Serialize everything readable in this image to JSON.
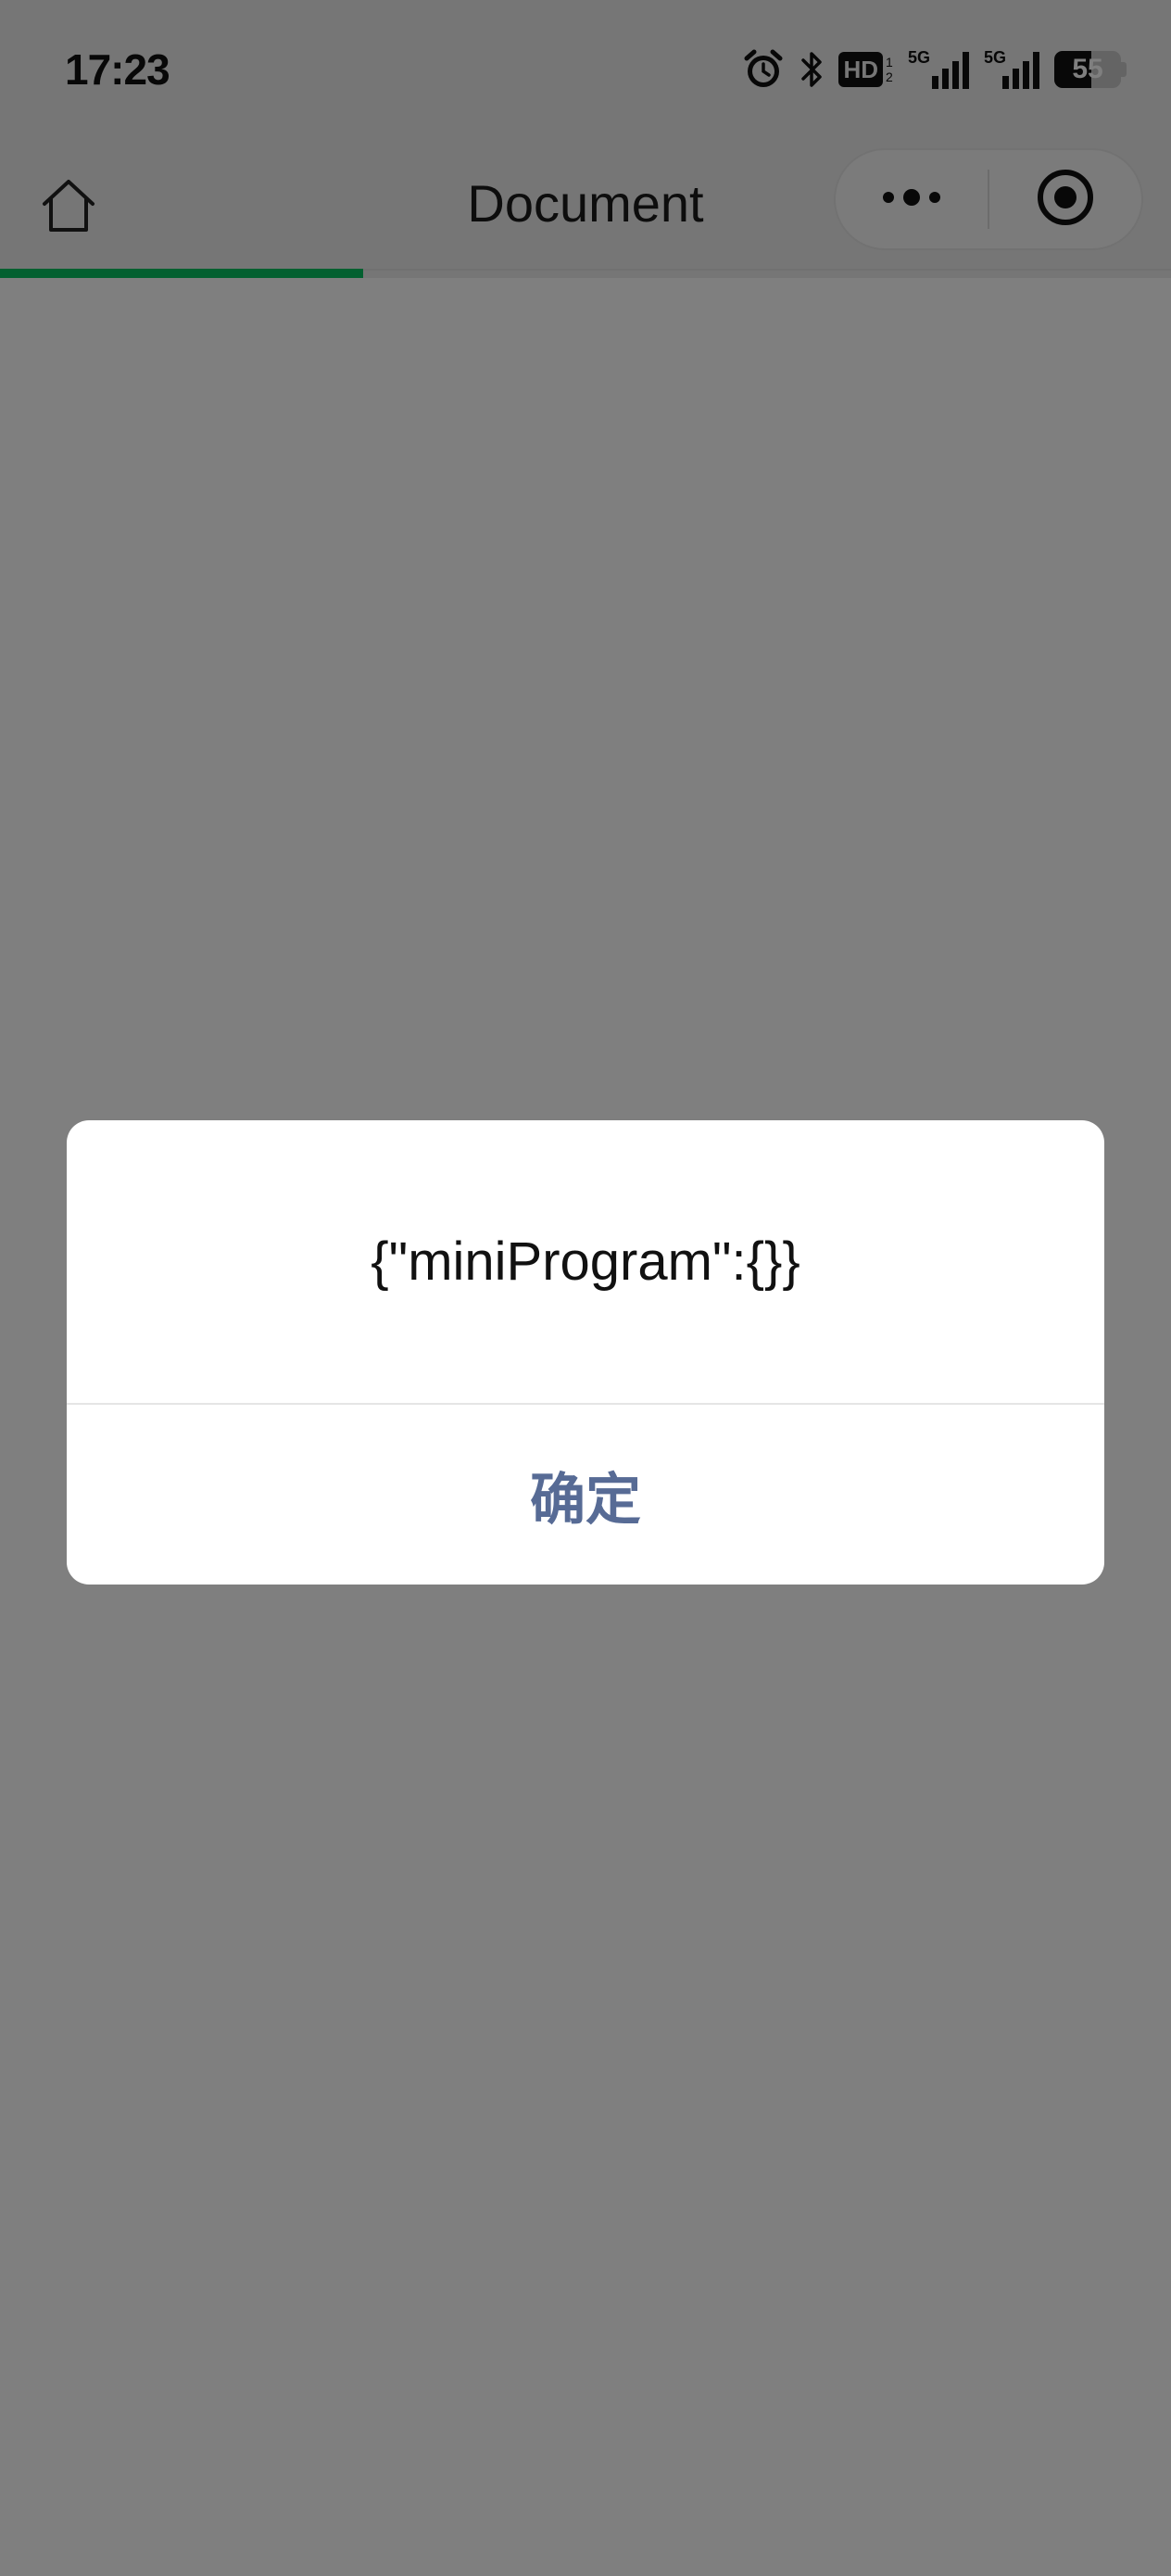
{
  "status_bar": {
    "time": "17:23",
    "hd_label": "HD",
    "hd_sub": "1 2",
    "net1_label": "5G",
    "net2_label": "5G",
    "battery": "55"
  },
  "nav": {
    "title": "Document",
    "home_icon": "home-icon",
    "more_icon": "more-dots-icon",
    "close_icon": "target-close-icon"
  },
  "progress": {
    "value": 0.31,
    "color": "#07c160"
  },
  "modal": {
    "content": "{\"miniProgram\":{}}",
    "confirm_label": "确定",
    "confirm_color": "#576b95"
  }
}
